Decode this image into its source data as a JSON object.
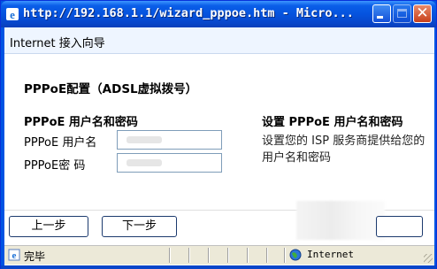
{
  "window": {
    "title": "http://192.168.1.1/wizard_pppoe.htm - Micro..."
  },
  "wizard": {
    "header": "Internet 接入向导",
    "config_title": "PPPoE配置（ADSL虚拟拨号）",
    "left_subtitle": "PPPoE 用户名和密码",
    "right_subtitle": "设置 PPPoE 用户名和密码",
    "username_label": "PPPoE 用户名",
    "password_label": "PPPoE密  码",
    "description": "设置您的 ISP 服务商提供给您的用户名和密码"
  },
  "buttons": {
    "prev_label": "上一步",
    "next_label": "下一步"
  },
  "statusbar": {
    "text": "完毕",
    "zone": "Internet"
  },
  "icons": {
    "title": "ie-icon",
    "status": "page-icon",
    "zone": "globe-icon"
  }
}
